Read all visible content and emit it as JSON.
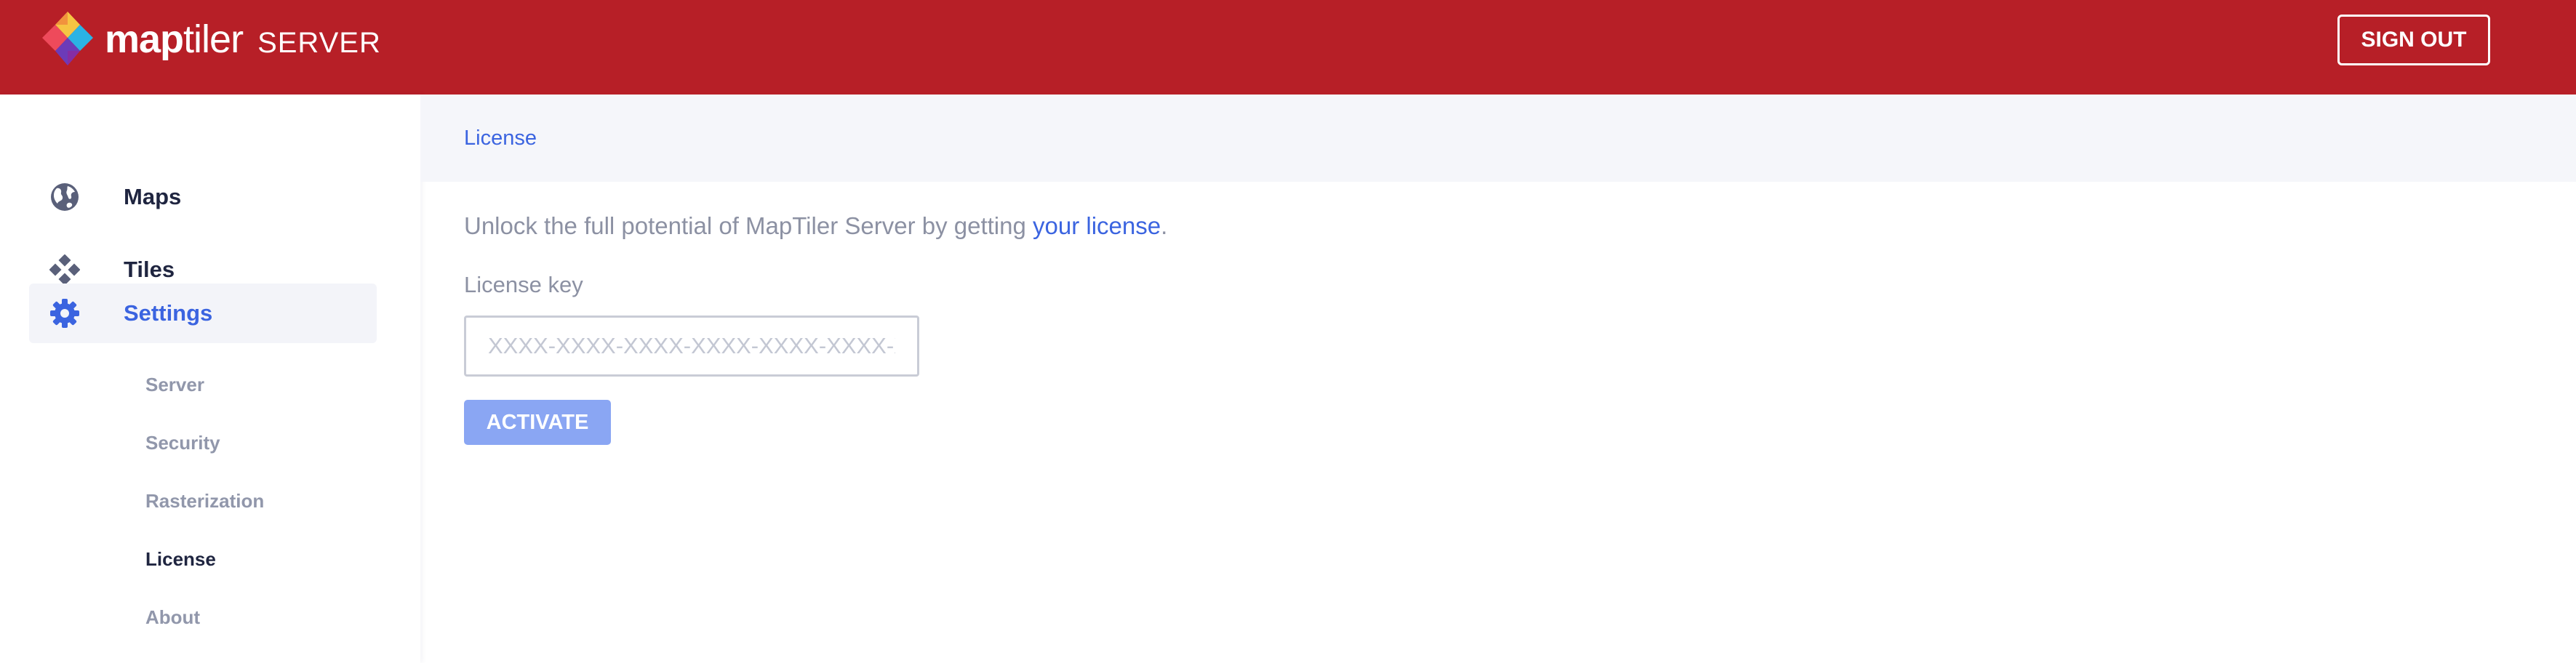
{
  "header": {
    "logo_primary": "map",
    "logo_secondary": "tiler",
    "logo_product": "SERVER",
    "sign_out_label": "SIGN OUT",
    "bar_color": "#b71f27"
  },
  "sidebar": {
    "items": [
      {
        "label": "Maps",
        "icon": "globe-icon",
        "active": false
      },
      {
        "label": "Tiles",
        "icon": "tiles-icon",
        "active": false
      },
      {
        "label": "Settings",
        "icon": "gear-icon",
        "active": true
      }
    ],
    "settings_subitems": [
      {
        "label": "Server",
        "current": false
      },
      {
        "label": "Security",
        "current": false
      },
      {
        "label": "Rasterization",
        "current": false
      },
      {
        "label": "License",
        "current": true
      },
      {
        "label": "About",
        "current": false
      }
    ]
  },
  "breadcrumb": {
    "current": "License"
  },
  "license": {
    "intro_text": "Unlock the full potential of MapTiler Server by getting ",
    "intro_link": "your license",
    "intro_suffix": ".",
    "key_label": "License key",
    "key_value": "",
    "key_placeholder": "XXXX-XXXX-XXXX-XXXX-XXXX-XXXX-XXXX",
    "activate_label": "ACTIVATE"
  },
  "colors": {
    "accent": "#3b64e0",
    "activate_button": "#8aa6f3",
    "muted_text": "#8c91a3"
  }
}
